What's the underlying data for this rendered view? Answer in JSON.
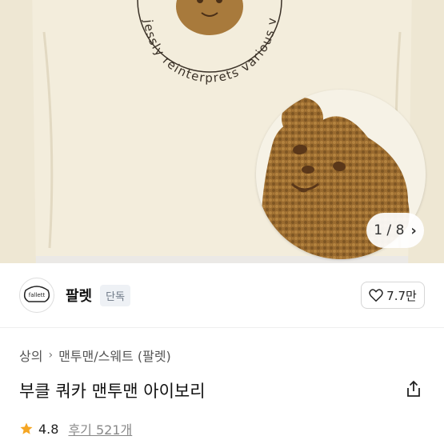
{
  "gallery": {
    "embroidery_text": "jessly reinterprets various visual",
    "pager_current": "1",
    "pager_separator": "/",
    "pager_total": "8"
  },
  "seller": {
    "logo_text": "fallett",
    "name": "팔렛",
    "badge": "단독",
    "like_count": "7.7만"
  },
  "breadcrumb": [
    "상의",
    "맨투맨/스웨트 (팔렛)"
  ],
  "product": {
    "title": "부클 쿼카 맨투맨 아이보리"
  },
  "rating": {
    "score": "4.8",
    "reviews": "후기 521개"
  },
  "colors": {
    "star": "#f5a623",
    "sweater": "#f3eddc",
    "bear": "#9a6b2f"
  }
}
